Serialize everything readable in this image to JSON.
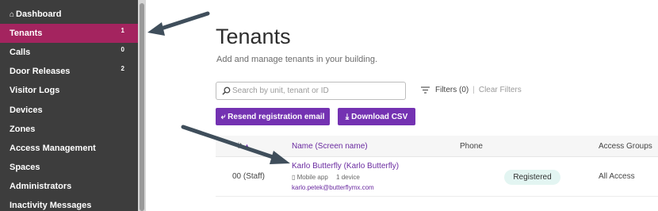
{
  "sidebar": {
    "items": [
      {
        "label": "Dashboard",
        "icon": "home-icon",
        "badge": ""
      },
      {
        "label": "Tenants",
        "badge": "1",
        "active": true
      },
      {
        "label": "Calls",
        "badge": "0"
      },
      {
        "label": "Door Releases",
        "badge": "2"
      },
      {
        "label": "Visitor Logs",
        "badge": ""
      },
      {
        "label": "Devices",
        "badge": ""
      },
      {
        "label": "Zones",
        "badge": ""
      },
      {
        "label": "Access Management",
        "badge": ""
      },
      {
        "label": "Spaces",
        "badge": ""
      },
      {
        "label": "Administrators",
        "badge": ""
      },
      {
        "label": "Inactivity Messages",
        "badge": ""
      }
    ]
  },
  "main": {
    "title": "Tenants",
    "subtitle": "Add and manage tenants in your building.",
    "search_placeholder": "Search by unit, tenant or ID",
    "filters_label": "Filters (0)",
    "clear_filters_label": "Clear Filters",
    "resend_button": "Resend registration email",
    "download_button": "Download CSV"
  },
  "table": {
    "headers": {
      "unit": "it",
      "name": "Name (Screen name)",
      "phone": "Phone",
      "groups": "Access Groups"
    },
    "rows": [
      {
        "unit": "00 (Staff)",
        "name": "Karlo Butterfly (Karlo Butterfly)",
        "app": "Mobile app",
        "devices": "1 device",
        "email": "karlo.petek@butterflymx.com",
        "status": "Registered",
        "groups": "All Access"
      }
    ]
  },
  "colors": {
    "sidebar_bg": "#3d3d3d",
    "sidebar_active": "#a4245f",
    "accent_purple": "#7432b2",
    "badge_green": "#e3f5f2"
  }
}
